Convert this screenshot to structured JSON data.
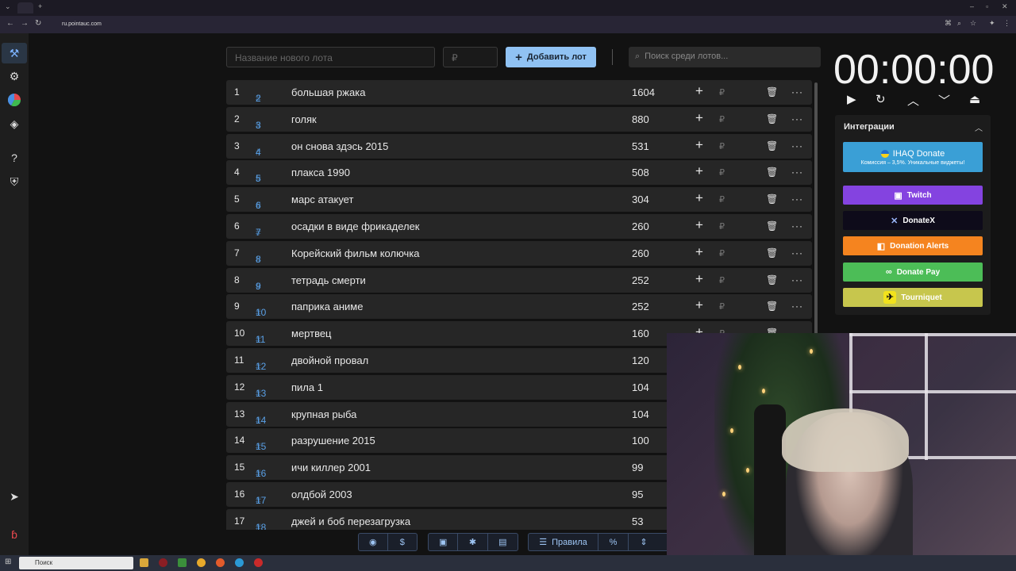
{
  "browser": {
    "url": "ru.pointauc.com"
  },
  "toolbar": {
    "lot_name_placeholder": "Название нового лота",
    "amount_placeholder": "₽",
    "add_lot_label": "Добавить лот",
    "search_placeholder": "Поиск среди лотов..."
  },
  "lots": [
    {
      "index": "1",
      "id": "2",
      "name": "большая ржака",
      "amount": "1604"
    },
    {
      "index": "2",
      "id": "3",
      "name": "голяк",
      "amount": "880"
    },
    {
      "index": "3",
      "id": "4",
      "name": "он снова здэсь 2015",
      "amount": "531"
    },
    {
      "index": "4",
      "id": "5",
      "name": "плакса 1990",
      "amount": "508"
    },
    {
      "index": "5",
      "id": "6",
      "name": "марс атакует",
      "amount": "304"
    },
    {
      "index": "6",
      "id": "7",
      "name": "осадки в виде фрикаделек",
      "amount": "260"
    },
    {
      "index": "7",
      "id": "8",
      "name": "Корейский фильм колючка",
      "amount": "260"
    },
    {
      "index": "8",
      "id": "9",
      "name": "тетрадь смерти",
      "amount": "252"
    },
    {
      "index": "9",
      "id": "10",
      "name": "паприка аниме",
      "amount": "252"
    },
    {
      "index": "10",
      "id": "11",
      "name": "мертвец",
      "amount": "160"
    },
    {
      "index": "11",
      "id": "12",
      "name": " двойной провал",
      "amount": "120"
    },
    {
      "index": "12",
      "id": "13",
      "name": "пила 1",
      "amount": "104"
    },
    {
      "index": "13",
      "id": "14",
      "name": "крупная рыба",
      "amount": "104"
    },
    {
      "index": "14",
      "id": "15",
      "name": "разрушение 2015",
      "amount": "100"
    },
    {
      "index": "15",
      "id": "16",
      "name": "ичи киллер 2001",
      "amount": "99"
    },
    {
      "index": "16",
      "id": "17",
      "name": "олдбой 2003",
      "amount": "95"
    },
    {
      "index": "17",
      "id": "18",
      "name": "джей и боб перезагрузка",
      "amount": "53"
    }
  ],
  "row_symbols": {
    "hash": "#",
    "plus": "+",
    "rub": "₽",
    "more": "···"
  },
  "timer": {
    "value": "00:00:00"
  },
  "integrations": {
    "title": "Интеграции",
    "items": [
      {
        "label": "IHAQ Donate",
        "sub": "Комиссия – 3,5%. Уникальные виджеты!",
        "color": "#3a9fd6"
      },
      {
        "label": "Twitch",
        "color": "#8443e0"
      },
      {
        "label": "DonateX",
        "color": "#0e0b1a"
      },
      {
        "label": "Donation Alerts",
        "color": "#f5841f"
      },
      {
        "label": "Donate Pay",
        "color": "#4cbd57"
      },
      {
        "label": "Tourniquet",
        "color": "#c7c64d"
      }
    ]
  },
  "bottom_bar": {
    "rules_label": "Правила",
    "percent_label": "%"
  },
  "taskbar": {
    "search_label": "Поиск"
  },
  "accent_color": "#90c2f3"
}
